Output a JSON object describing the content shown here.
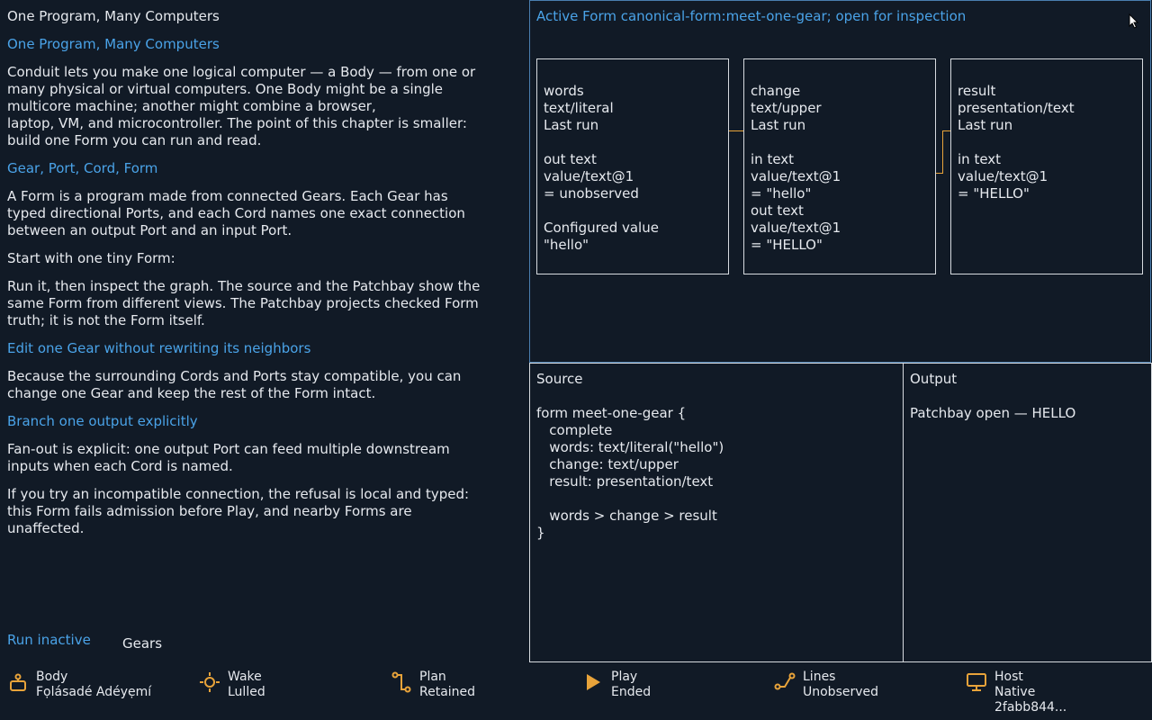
{
  "doc": {
    "title": "One Program, Many Computers",
    "heading1": "One Program, Many Computers",
    "p1": "Conduit lets you make one logical computer — a Body — from one or\nmany physical or virtual computers. One Body might be a single\nmulticore machine; another might combine a browser,\nlaptop, VM, and microcontroller. The point of this chapter is smaller:\nbuild one Form you can run and read.",
    "heading2": "Gear, Port, Cord, Form",
    "p2": "A Form is a program made from connected Gears. Each Gear has\ntyped directional Ports, and each Cord names one exact connection\nbetween an output Port and an input Port.",
    "p3": "Start with one tiny Form:",
    "p4": "Run it, then inspect the graph. The source and the Patchbay show the\nsame Form from different views. The Patchbay projects checked Form\ntruth; it is not the Form itself.",
    "heading3": "Edit one Gear without rewriting its neighbors",
    "p5": "Because the surrounding Cords and Ports stay compatible, you can\nchange one Gear and keep the rest of the Form intact.",
    "heading4": "Branch one output explicitly",
    "p6": "Fan-out is explicit: one output Port can feed multiple downstream\ninputs when each Cord is named.",
    "p7": "If you try an incompatible connection, the refusal is local and typed:\nthis Form fails admission before Play, and nearby Forms are\nunaffected."
  },
  "controls": {
    "run_label": "Run inactive",
    "gears_label": "Gears"
  },
  "inspector": {
    "title": "Active Form canonical-form:meet-one-gear; open for inspection",
    "cards": [
      {
        "text": "words\ntext/literal\nLast run\n\nout text\nvalue/text@1\n= unobserved\n\nConfigured value\n\"hello\""
      },
      {
        "text": "change\ntext/upper\nLast run\n\nin text\nvalue/text@1\n= \"hello\"\nout text\nvalue/text@1\n= \"HELLO\""
      },
      {
        "text": "result\npresentation/text\nLast run\n\nin text\nvalue/text@1\n= \"HELLO\""
      }
    ]
  },
  "source": {
    "title": "Source",
    "code": "form meet-one-gear {\n   complete\n   words: text/literal(\"hello\")\n   change: text/upper\n   result: presentation/text\n\n   words > change > result\n}"
  },
  "output": {
    "title": "Output",
    "text": "Patchbay open — HELLO"
  },
  "status": [
    {
      "icon": "body-icon",
      "label": "Body",
      "value": "Fọlásadé Adéyẹmí"
    },
    {
      "icon": "wake-icon",
      "label": "Wake",
      "value": "Lulled"
    },
    {
      "icon": "plan-icon",
      "label": "Plan",
      "value": "Retained"
    },
    {
      "icon": "play-icon",
      "label": "Play",
      "value": "Ended"
    },
    {
      "icon": "lines-icon",
      "label": "Lines",
      "value": "Unobserved"
    },
    {
      "icon": "host-icon",
      "label": "Host",
      "value": "Native",
      "extra": "2fabb844..."
    }
  ],
  "colors": {
    "accent": "#4aa3e8",
    "wire": "#e8a33a",
    "background": "#111a26",
    "text": "#e6e9ee"
  }
}
